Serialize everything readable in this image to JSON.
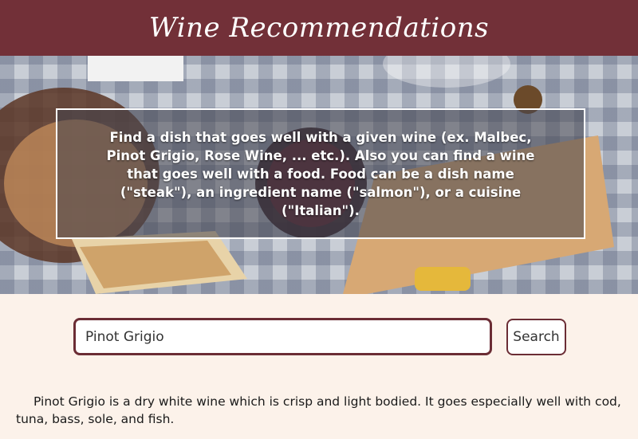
{
  "header": {
    "title": "Wine Recommendations"
  },
  "hero": {
    "description": "Find a dish that goes well with a given wine (ex. Malbec, Pinot Grigio, Rose Wine, ... etc.).  Also you can find a wine that goes well with a food.  Food can be a dish name (\"steak\"), an ingredient name (\"salmon\"), or a cuisine (\"Italian\")."
  },
  "search": {
    "value": "Pinot Grigio",
    "button_label": "Search"
  },
  "result": {
    "text": "Pinot Grigio is a dry white wine which is crisp and light bodied. It goes especially well with cod, tuna, bass, sole, and fish."
  },
  "colors": {
    "brand": "#723038",
    "page_background": "#fcf2ea",
    "accent_border": "#6b2d35"
  }
}
